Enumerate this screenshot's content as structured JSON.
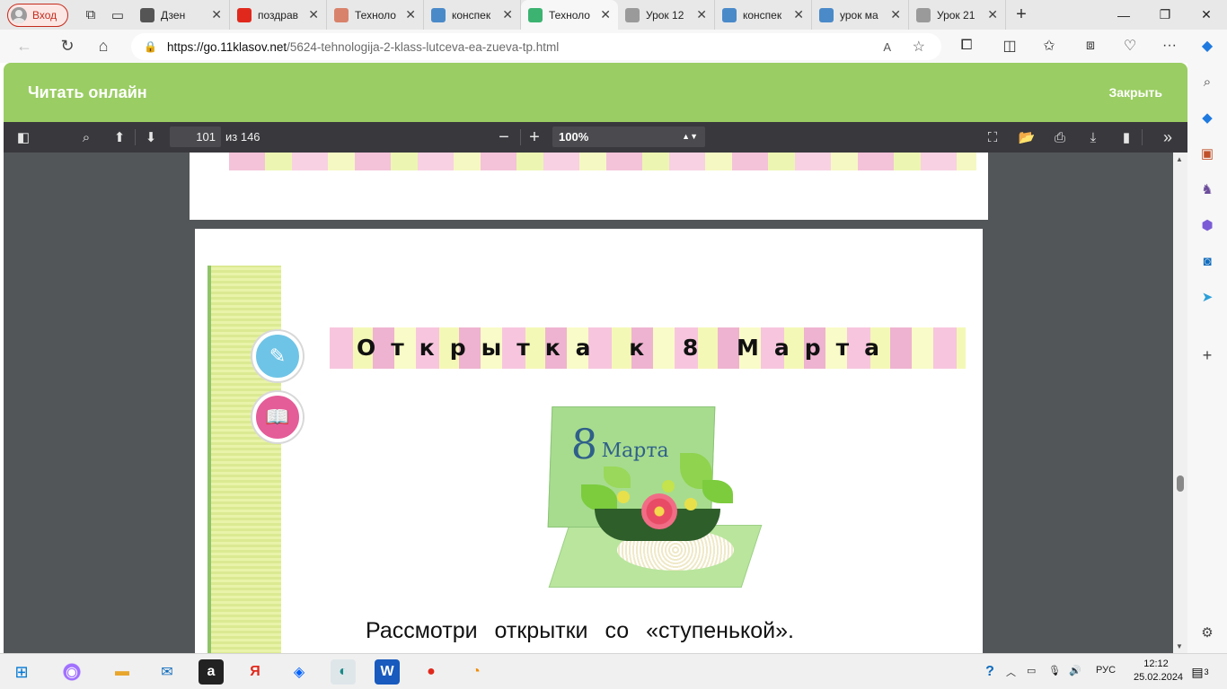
{
  "browser": {
    "profile_label": "Вход",
    "tabs": [
      {
        "label": "Дзен",
        "icon": "zen-icon",
        "color": "#555555"
      },
      {
        "label": "поздрав",
        "icon": "yandex-icon",
        "color": "#e0291c"
      },
      {
        "label": "Техноло",
        "icon": "page-icon",
        "color": "#d9826b"
      },
      {
        "label": "конспек",
        "icon": "check-icon",
        "color": "#4a8ac9"
      },
      {
        "label": "Техноло",
        "icon": "book-icon",
        "color": "#3cb371",
        "active": true
      },
      {
        "label": "Урок 12",
        "icon": "doc-icon",
        "color": "#9a9a9a"
      },
      {
        "label": "конспек",
        "icon": "check-icon",
        "color": "#4a8ac9"
      },
      {
        "label": "урок ма",
        "icon": "check-icon",
        "color": "#4a8ac9"
      },
      {
        "label": "Урок 21",
        "icon": "doc-icon",
        "color": "#9a9a9a"
      }
    ],
    "url_main": "https://go.11klasov.net",
    "url_path": "/5624-tehnologija-2-klass-lutceva-ea-zueva-tp.html",
    "read_aloud": "A",
    "window_controls": {
      "minimize": "—",
      "maximize": "❐",
      "close": "✕"
    }
  },
  "reader": {
    "title": "Читать онлайн",
    "close_label": "Закрыть",
    "page_number": "101",
    "page_of": "из 146",
    "zoom": "100%"
  },
  "book_page": {
    "heading": "Открытка к 8 Марта",
    "card_number": "8",
    "card_text": "Марта",
    "caption": "Рассмотри открытки со «ступенькой»."
  },
  "taskbar": {
    "language": "РУС",
    "time": "12:12",
    "date": "25.02.2024",
    "notifications": "3"
  },
  "colors": {
    "green_header": "#9acd63",
    "pdf_toolbar": "#38383d",
    "pdf_background": "#525659"
  }
}
